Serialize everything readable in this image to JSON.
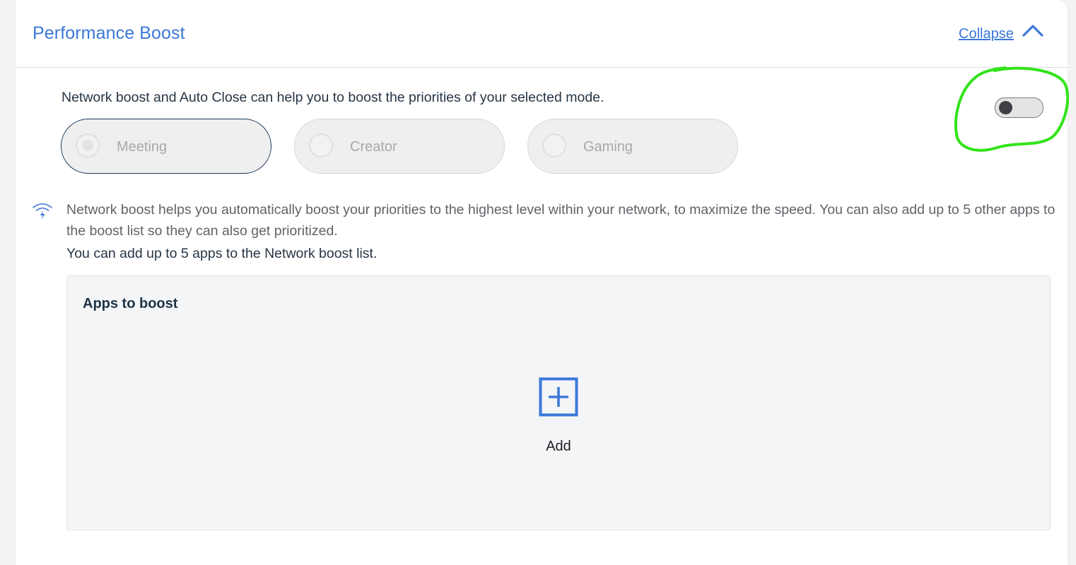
{
  "header": {
    "title": "Performance Boost",
    "collapse_label": "Collapse",
    "collapse_icon": "chevron-up-icon"
  },
  "intro_text": "Network boost and Auto Close can help you to boost the priorities of your selected mode.",
  "modes": [
    {
      "label": "Meeting",
      "selected": true
    },
    {
      "label": "Creator",
      "selected": false
    },
    {
      "label": "Gaming",
      "selected": false
    }
  ],
  "toggle": {
    "on": false
  },
  "network": {
    "icon": "wifi-bolt-icon",
    "description": "Network boost helps you automatically boost your priorities to the highest level within your network, to maximize the speed. You can also add up to 5 other apps to the boost list so they can also get prioritized.",
    "limit_text": "You can add up to 5 apps to the Network boost list."
  },
  "apps": {
    "title": "Apps to boost",
    "add_label": "Add",
    "add_icon": "plus-square-icon"
  },
  "colors": {
    "accent": "#3c78d8",
    "annotation": "#33e31a",
    "text_dark": "#263545",
    "text_muted": "#5f6368"
  }
}
